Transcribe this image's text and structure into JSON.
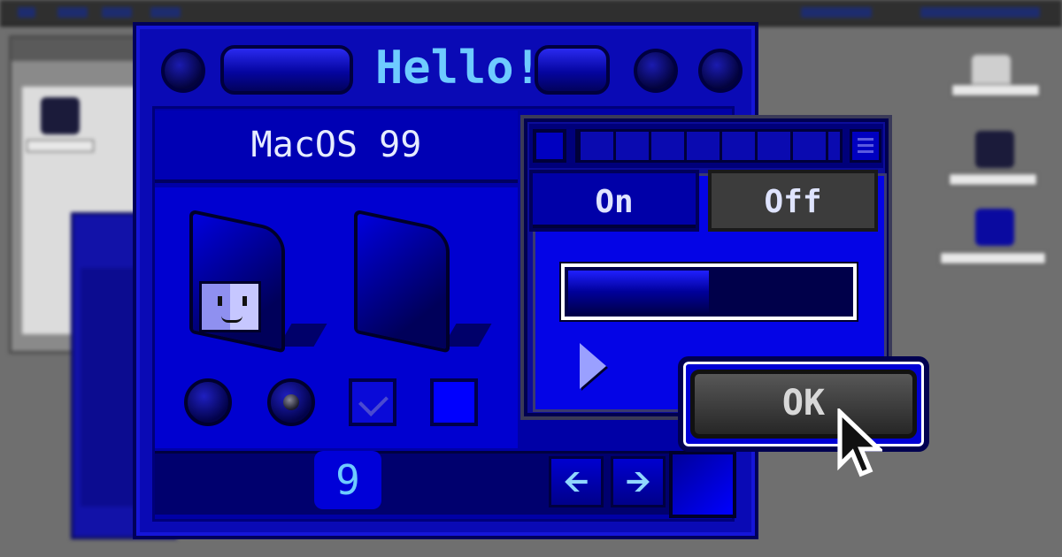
{
  "window": {
    "title": "Hello!"
  },
  "panel": {
    "os_label": "MacOS 99",
    "page_number": "9"
  },
  "controls": {
    "radio_buttons": [
      {
        "state": "off"
      },
      {
        "state": "on"
      }
    ],
    "checkboxes": [
      {
        "checked": true
      },
      {
        "checked": false
      }
    ]
  },
  "navigation": {
    "back_icon": "left-arrow-icon",
    "forward_icon": "right-arrow-icon"
  },
  "settings": {
    "toggle_on_label": "On",
    "toggle_off_label": "Off",
    "progress": 0.5
  },
  "dialog": {
    "ok_label": "OK"
  },
  "colors": {
    "window_blue": "#0a0ab5",
    "title_text": "#6ecbff",
    "button_gray": "#3c3c3c"
  }
}
